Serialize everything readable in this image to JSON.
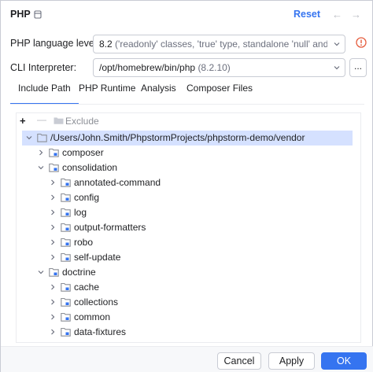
{
  "header": {
    "title": "PHP",
    "reset_label": "Reset",
    "back_arrow": "←",
    "forward_arrow": "→"
  },
  "form": {
    "language_level": {
      "label": "PHP language level:",
      "value": "8.2",
      "description": "('readonly' classes, 'true' type, standalone 'null' and 'false"
    },
    "cli_interpreter": {
      "label": "CLI Interpreter:",
      "value": "/opt/homebrew/bin/php",
      "version": "(8.2.10)",
      "more_label": "..."
    }
  },
  "tabs": [
    {
      "label": "Include Path",
      "active": true
    },
    {
      "label": "PHP Runtime",
      "active": false
    },
    {
      "label": "Analysis",
      "active": false
    },
    {
      "label": "Composer Files",
      "active": false
    }
  ],
  "toolbar": {
    "add_label": "+",
    "remove_label": "—",
    "exclude_label": "Exclude"
  },
  "tree": [
    {
      "label": "/Users/John.Smith/PhpstormProjects/phpstorm-demo/vendor",
      "depth": 0,
      "expanded": true,
      "selected": true
    },
    {
      "label": "composer",
      "depth": 1,
      "expanded": false
    },
    {
      "label": "consolidation",
      "depth": 1,
      "expanded": true
    },
    {
      "label": "annotated-command",
      "depth": 2,
      "expanded": false
    },
    {
      "label": "config",
      "depth": 2,
      "expanded": false
    },
    {
      "label": "log",
      "depth": 2,
      "expanded": false
    },
    {
      "label": "output-formatters",
      "depth": 2,
      "expanded": false
    },
    {
      "label": "robo",
      "depth": 2,
      "expanded": false
    },
    {
      "label": "self-update",
      "depth": 2,
      "expanded": false
    },
    {
      "label": "doctrine",
      "depth": 1,
      "expanded": true
    },
    {
      "label": "cache",
      "depth": 2,
      "expanded": false
    },
    {
      "label": "collections",
      "depth": 2,
      "expanded": false
    },
    {
      "label": "common",
      "depth": 2,
      "expanded": false
    },
    {
      "label": "data-fixtures",
      "depth": 2,
      "expanded": false
    }
  ],
  "footer": {
    "cancel_label": "Cancel",
    "apply_label": "Apply",
    "ok_label": "OK"
  },
  "colors": {
    "accent": "#3574f0",
    "selection": "#d5e1ff",
    "warning": "#e55b3c",
    "folder": "#8c8f96"
  }
}
